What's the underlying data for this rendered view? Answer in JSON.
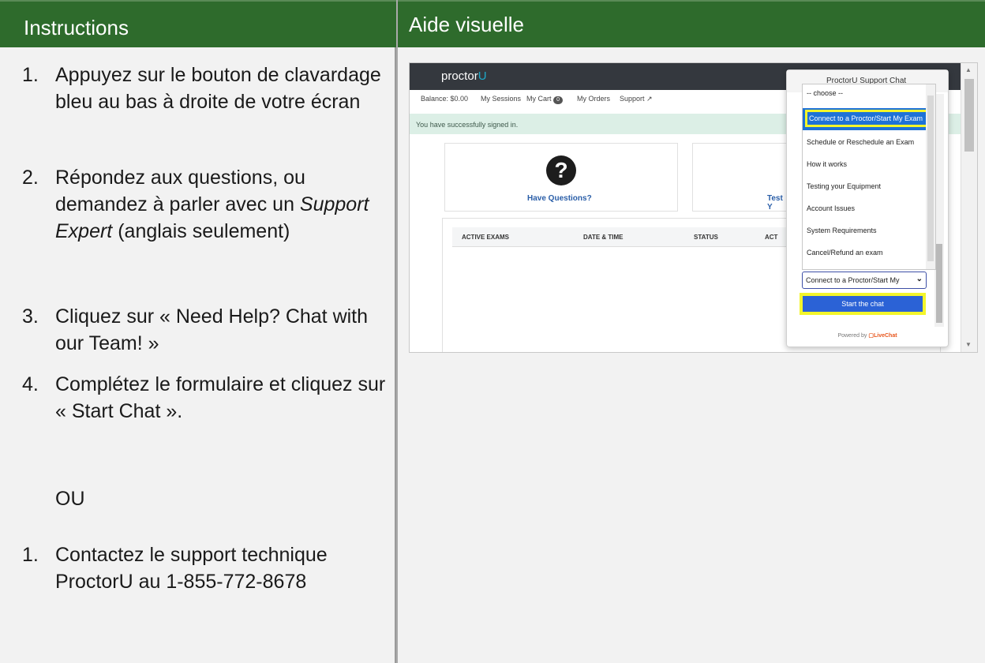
{
  "left": {
    "header": "Instructions",
    "steps": [
      {
        "num": "1.",
        "text": "Appuyez sur le bouton de clavardage bleu au bas à droite de votre écran"
      },
      {
        "num": "2.",
        "text_before": "Répondez aux questions, ou demandez à parler avec un ",
        "text_em": "Support Expert",
        "text_after": " (anglais seulement)"
      },
      {
        "num": "3.",
        "text": "Cliquez sur « Need Help? Chat with our Team! »"
      },
      {
        "num": "4.",
        "text": "Complétez le formulaire et cliquez sur « Start Chat »."
      }
    ],
    "or": "OU",
    "alt_step": {
      "num": "1.",
      "text": "Contactez le support technique ProctorU au 1-855-772-8678"
    }
  },
  "right": {
    "header": "Aide visuelle",
    "screenshot": {
      "logo_text": "proctor",
      "logo_accent": "U",
      "nav": {
        "balance": "Balance: $0.00",
        "sessions": "My Sessions",
        "cart": "My Cart",
        "cart_count": "0",
        "orders": "My Orders",
        "support": "Support"
      },
      "success_message": "You have successfully signed in.",
      "card1_label": "Have Questions?",
      "card2_label": "Test Y",
      "table_headers": [
        "ACTIVE EXAMS",
        "DATE & TIME",
        "STATUS",
        "ACT"
      ],
      "chat": {
        "title": "ProctorU Support Chat",
        "options": [
          "-- choose --",
          "Connect to a Proctor/Start My Exam",
          "Schedule or Reschedule an Exam",
          "How it works",
          "Testing your Equipment",
          "Account Issues",
          "System Requirements",
          "Cancel/Refund an exam"
        ],
        "selected_value": "Connect to a Proctor/Start My",
        "start_button": "Start the chat",
        "powered_by": "Powered by",
        "powered_brand": "LiveChat"
      }
    }
  },
  "colors": {
    "header_green": "#2e6b2c",
    "highlight_yellow": "#f3f52a",
    "option_blue": "#1e72d6",
    "button_blue": "#2b62d6"
  }
}
